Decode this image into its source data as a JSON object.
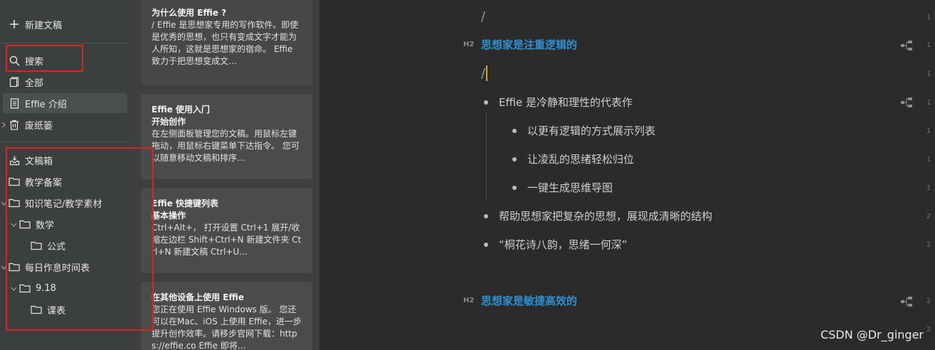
{
  "sidebar": {
    "new_doc": "新建文稿",
    "search": "搜索",
    "all": "全部",
    "effie_intro": "Effie 介绍",
    "trash": "废纸篓",
    "inbox": "文稿箱",
    "folders": {
      "teaching": "教学备案",
      "knowledge": "知识笔记/教学素材",
      "math": "数学",
      "formula": "公式",
      "schedule": "每日作息时间表",
      "date": "9.18",
      "classtable": "课表"
    }
  },
  "cards": [
    {
      "title": "为什么使用 Effie ?",
      "body": "/ Effie 是思想家专用的写作软件。即使是优秀的思想，也只有变成文字才能为人所知，这就是思想家的宿命。 Effie 致力于把思想变成文…"
    },
    {
      "title": "Effie 使用入门",
      "subtitle": "开始创作",
      "body": "在左侧面板管理您的文稿。用鼠标左键拖动，用鼠标右键菜单下达指令。 您可以随意移动文稿和排序…"
    },
    {
      "title": "Effie 快捷键列表",
      "subtitle": "基本操作",
      "body": "Ctrl+Alt+， 打开设置 Ctrl+1 展开/收缩左边栏 Shift+Ctrl+N 新建文件夹 Ctrl+N 新建文稿 Ctrl+U…"
    },
    {
      "title": "在其他设备上使用 Effie",
      "body": "您正在使用 Effie Windows 版。 您还可以在Mac、iOS 上使用 Effie，进一步提升创作效率。请移步官网下载：https://effie.co Effie 即将…"
    }
  ],
  "editor": {
    "slash1": "/",
    "h2_tag": "H2",
    "heading1": "思想家是注重逻辑的",
    "slash2": "/",
    "bullet1": "Effie 是冷静和理性的代表作",
    "sub1": "以更有逻辑的方式展示列表",
    "sub2": "让凌乱的思绪轻松归位",
    "sub3": "一键生成思维导图",
    "bullet2": "帮助思想家把复杂的思想，展现成清晰的结构",
    "bullet3": "“桐花诗八韵，思绪一何深”",
    "heading2": "思想家是敏捷高效的",
    "line_numbers": [
      "1",
      "1",
      "1",
      "1",
      "1",
      "1",
      "1",
      "2",
      "2",
      "2",
      "2"
    ]
  },
  "watermark": "CSDN @Dr_ginger",
  "colors": {
    "sidebar_bg": "#3b3f3f",
    "cards_bg": "#3d3f40",
    "editor_bg": "#2b2b2b",
    "heading": "#2f8fd0",
    "highlight_box": "#e3211b",
    "cursor": "#e8a21c"
  }
}
